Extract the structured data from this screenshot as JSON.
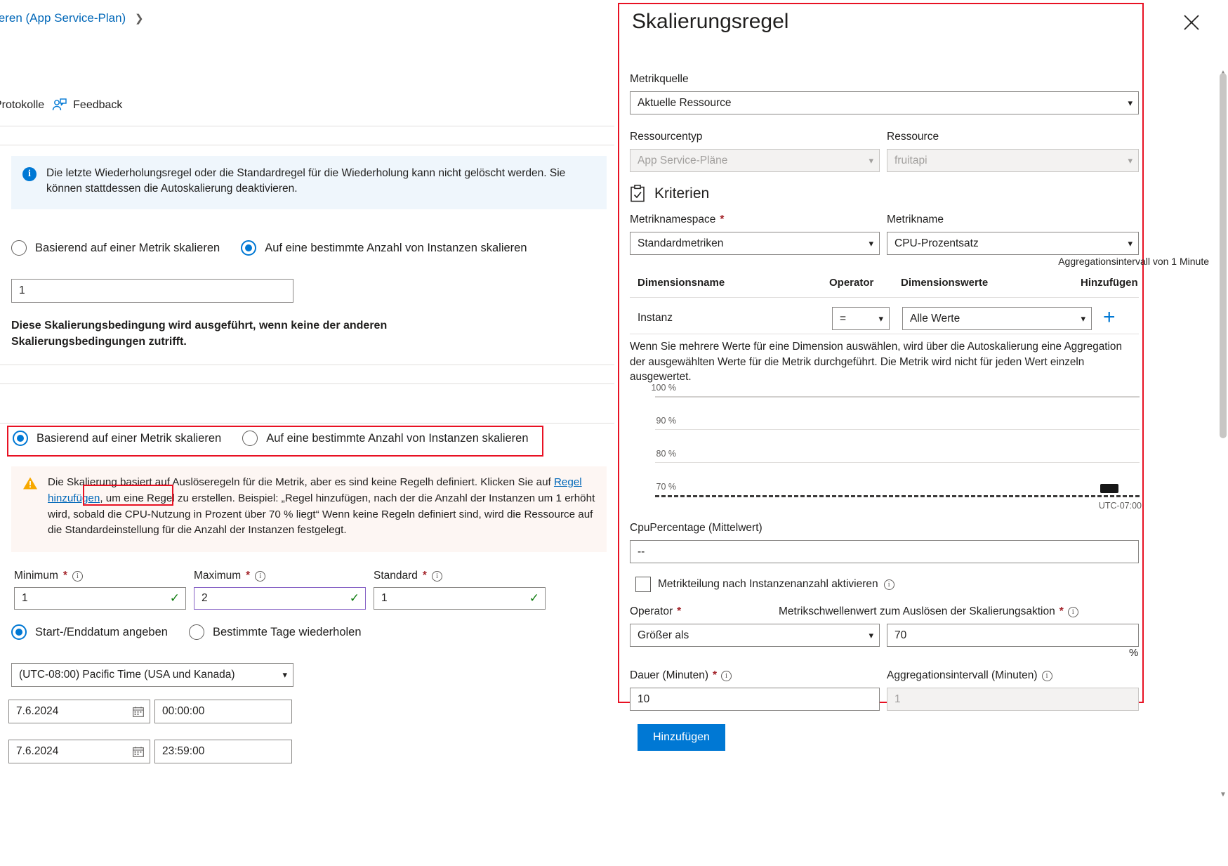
{
  "left": {
    "breadcrumb": "ieren (App Service-Plan)",
    "commands": {
      "logs": "Protokolle",
      "feedback": "Feedback"
    },
    "info_message": "Die letzte Wiederholungsregel oder die Standardregel für die Wiederholung kann nicht gelöscht werden. Sie können stattdessen die Autoskalierung deaktivieren.",
    "mode_top": {
      "metric_option": "Basierend auf einer Metrik skalieren",
      "instance_option": "Auf eine bestimmte Anzahl von Instanzen skalieren",
      "selected": "instance",
      "instance_count": "1"
    },
    "default_condition_note": "Diese Skalierungsbedingung wird ausgeführt, wenn keine der anderen Skalierungsbedingungen zutrifft.",
    "mode_bottom": {
      "metric_option": "Basierend auf einer Metrik skalieren",
      "instance_option": "Auf eine bestimmte Anzahl von Instanzen skalieren",
      "selected": "metric"
    },
    "warning": {
      "part1": "Die Skalierung basiert auf Auslöseregeln für die Metrik, aber es sind keine Regelh definiert. Klicken Sie auf ",
      "link": "Regel hinzufügen",
      "part2": ", um eine Regel zu erstellen. Beispiel: „Regel hinzufügen, nach der die Anzahl der Instanzen um 1 erhöht wird, sobald die CPU-Nutzung in Prozent über 70 % liegt“ Wenn keine Regeln definiert sind, wird die Ressource auf die Standardeinstellung für die Anzahl der Instanzen festgelegt."
    },
    "limits": {
      "minimum_label": "Minimum",
      "maximum_label": "Maximum",
      "default_label": "Standard",
      "minimum_value": "1",
      "maximum_value": "2",
      "default_value": "1"
    },
    "schedule": {
      "start_end_option": "Start-/Enddatum angeben",
      "repeat_days_option": "Bestimmte Tage wiederholen",
      "selected": "start_end",
      "timezone": "(UTC-08:00) Pacific Time (USA und Kanada)",
      "start_date": "7.6.2024",
      "start_time": "00:00:00",
      "end_date": "7.6.2024",
      "end_time": "23:59:00"
    }
  },
  "panel": {
    "title": "Skalierungsregel",
    "close_label": "✕",
    "metric_source_label": "Metrikquelle",
    "metric_source_value": "Aktuelle Ressource",
    "resource_type_label": "Ressourcentyp",
    "resource_type_value": "App Service-Pläne",
    "resource_label": "Ressource",
    "resource_value": "fruitapi",
    "criteria_heading": "Kriterien",
    "metric_namespace_label": "Metriknamespace",
    "metric_namespace_value": "Standardmetriken",
    "metric_name_label": "Metrikname",
    "metric_name_value": "CPU-Prozentsatz",
    "aggregation_note": "Aggregationsintervall von 1 Minute",
    "table": {
      "headers": [
        "Dimensionsname",
        "Operator",
        "Dimensionswerte",
        "Hinzufügen"
      ],
      "rows": [
        {
          "dimension": "Instanz",
          "operator": "=",
          "values": "Alle Werte",
          "add": "+"
        }
      ]
    },
    "dimension_help": "Wenn Sie mehrere Werte für eine Dimension auswählen, wird über die Autoskalierung eine Aggregation der ausgewählten Werte für die Metrik durchgeführt. Die Metrik wird nicht für jeden Wert einzeln ausgewertet.",
    "metric_value_label": "CpuPercentage (Mittelwert)",
    "metric_value_value": "--",
    "split_checkbox_label": "Metrikteilung nach Instanzenanzahl aktivieren",
    "split_checkbox_checked": false,
    "operator_label": "Operator",
    "operator_value": "Größer als",
    "threshold_label": "Metrikschwellenwert zum Auslösen der Skalierungsaktion",
    "threshold_value": "70",
    "threshold_unit": "%",
    "duration_label": "Dauer (Minuten)",
    "duration_value": "10",
    "agg_interval_label": "Aggregationsintervall (Minuten)",
    "agg_interval_value": "1",
    "add_button": "Hinzufügen"
  },
  "chart_data": {
    "type": "line",
    "title": "",
    "xlabel": "",
    "ylabel": "",
    "yticks": [
      "100 %",
      "90 %",
      "80 %",
      "70 %"
    ],
    "ylim": [
      70,
      100
    ],
    "timezone_label": "UTC-07:00",
    "threshold": 70,
    "threshold_style": "dashed",
    "series": [
      {
        "name": "CpuPercentage (Mittelwert)",
        "values": []
      }
    ],
    "grid": true,
    "legend": "none"
  },
  "colors": {
    "accent": "#0078d4",
    "highlight": "#e81123",
    "link": "#0067b8",
    "warning_bg": "#fdf6f3",
    "info_bg": "#eff6fc",
    "success": "#107c10"
  }
}
